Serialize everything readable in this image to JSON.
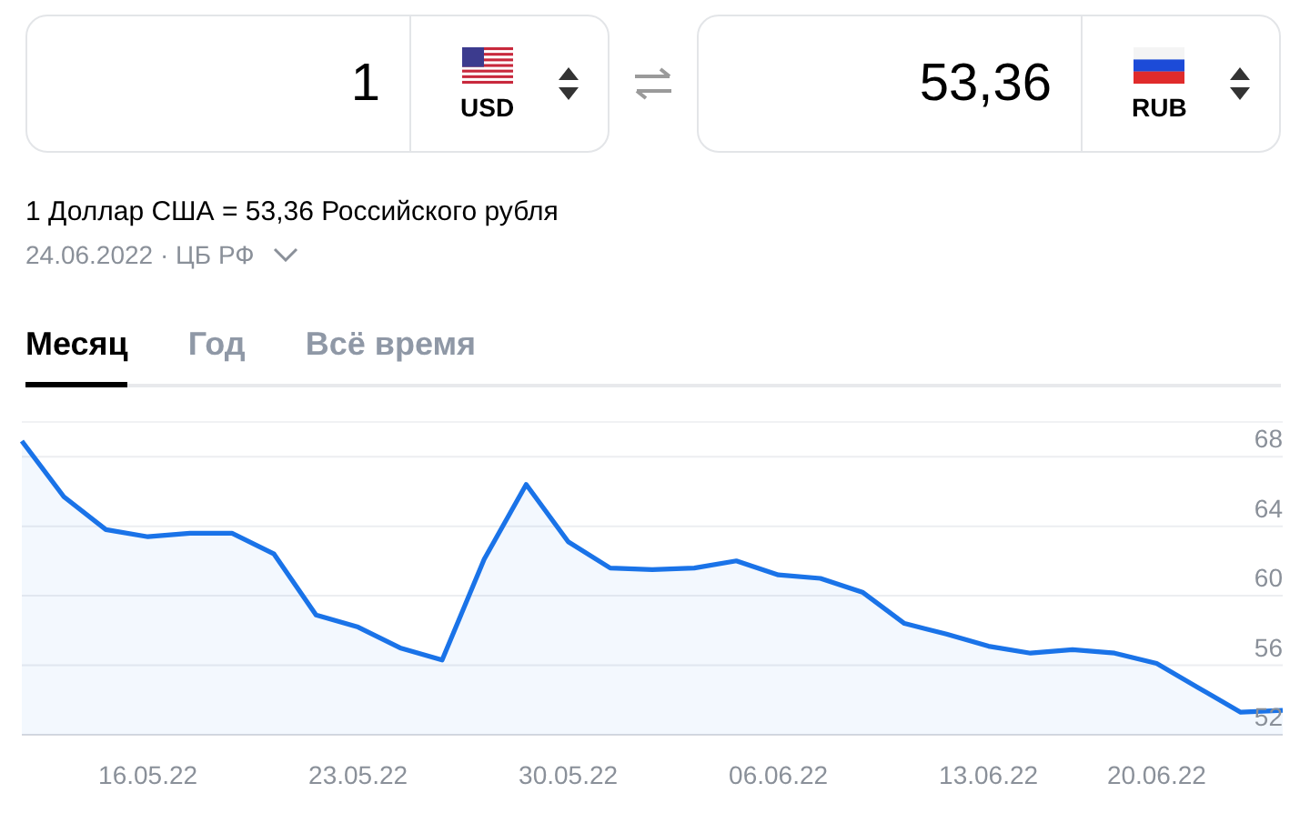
{
  "converter": [
    {
      "amount": "1",
      "currency": "USD"
    },
    {
      "amount": "53,36",
      "currency": "RUB"
    }
  ],
  "rate_text": "1 Доллар США = 53,36 Российского рубля",
  "rate_source": "24.06.2022 · ЦБ РФ",
  "tabs": [
    {
      "label": "Месяц",
      "selected": true
    },
    {
      "label": "Год",
      "selected": false
    },
    {
      "label": "Всё время",
      "selected": false
    }
  ],
  "chart_data": {
    "type": "area",
    "categories": [
      null,
      null,
      null,
      "16.05.22",
      null,
      null,
      null,
      null,
      "23.05.22",
      null,
      null,
      null,
      null,
      "30.05.22",
      null,
      null,
      null,
      null,
      "06.06.22",
      null,
      null,
      null,
      null,
      "13.06.22",
      null,
      null,
      null,
      "20.06.22",
      null,
      null,
      null
    ],
    "series": [
      {
        "color": "#1a73e8",
        "values": [
          68.9,
          65.7,
          63.8,
          63.4,
          63.6,
          63.6,
          62.4,
          58.9,
          58.2,
          57.0,
          56.3,
          62.1,
          66.4,
          63.1,
          61.6,
          61.5,
          61.6,
          62.0,
          61.2,
          61.0,
          60.2,
          58.4,
          57.8,
          57.1,
          56.7,
          56.9,
          56.7,
          56.1,
          54.7,
          53.3,
          53.4
        ]
      }
    ],
    "grid": true,
    "ylim": [
      52,
      70
    ],
    "yticks": [
      52,
      56,
      60,
      64,
      68
    ]
  }
}
